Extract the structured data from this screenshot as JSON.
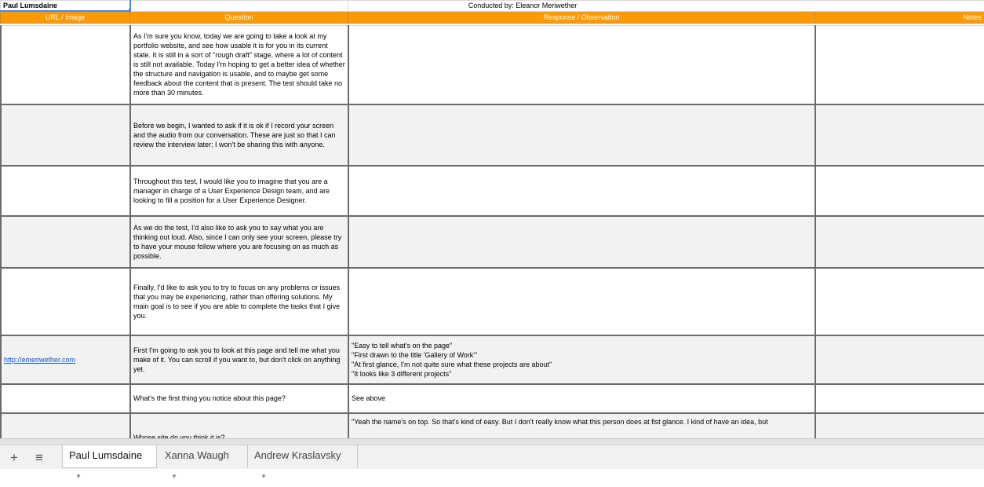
{
  "info_row": {
    "participant": "Paul Lumsdaine",
    "conductor": "Conducted by: Eleanor Meriwether"
  },
  "headers": {
    "url_image": "URL / Image",
    "question": "Question",
    "response": "Response / Observation",
    "notes": "Notes"
  },
  "rows": [
    {
      "url": "",
      "question": "As I'm sure you know, today we are going to take a look at my portfolio website, and see how usable it is for you in its current state. It is still in a sort of \"rough draft\" stage, where a lot of content is still not available. Today I'm hoping to get a better idea of whether the structure and navigation is usable, and to maybe get some feedback about the content that is present. The test should take no more than 30 minutes.",
      "response": [],
      "notes": ""
    },
    {
      "url": "",
      "question": "Before we begin, I wanted to ask if it is ok if I record your screen and the audio from our conversation. These are just so that I can review the interview later; I won't be sharing this with anyone.",
      "response": [],
      "notes": ""
    },
    {
      "url": "",
      "question": "Throughout this test, I would like you to imagine that you are a manager in charge of a User Experience Design team, and are looking to fill a position for a User Experience Designer.",
      "response": [],
      "notes": ""
    },
    {
      "url": "",
      "question": "As we do the test, I'd also like to ask you to say what you are thinking out loud. Also, since I can only see your screen, please try to have your mouse follow where you are focusing on as much as possible.",
      "response": [],
      "notes": ""
    },
    {
      "url": "",
      "question": "Finally, I'd like to ask you to try to focus on any problems or issues that you may be experiencing, rather than offering solutions. My main goal is to see if you are able to complete the tasks that I give you.",
      "response": [],
      "notes": ""
    },
    {
      "url": "http://emeriwether.com",
      "question": "First I'm going to ask you to look at this page and tell me what you make of it. You can scroll if you want to, but don't click on anything yet.",
      "response": [
        "\"Easy to tell what's on the page\"",
        "\"First drawn to the title 'Gallery of Work'\"",
        "\"At first glance, I'm not quite sure what these projects are about\"",
        "\"It looks like 3 different projects\""
      ],
      "notes": ""
    },
    {
      "url": "",
      "question": "What's the first thing you notice about this page?",
      "response": [
        "See above"
      ],
      "notes": ""
    },
    {
      "url": "",
      "question": "Whose site do you think it is?",
      "response": [
        "\"Yeah the name's on top. So that's kind of easy. But I don't really know what this person does at fist glance. I kind of have an idea, but"
      ],
      "notes": ""
    }
  ],
  "tabs": {
    "add_icon": "plus-icon",
    "list_icon": "list-icon",
    "sheets": [
      "Paul Lumsdaine",
      "Xanna Waugh",
      "Andrew Kraslavsky"
    ]
  },
  "colors": {
    "header_orange": "#ff9900",
    "header_text": "#ffffff",
    "selection_blue": "#4a86e8",
    "link_blue": "#1155cc",
    "alt_row": "#f2f2f2"
  }
}
